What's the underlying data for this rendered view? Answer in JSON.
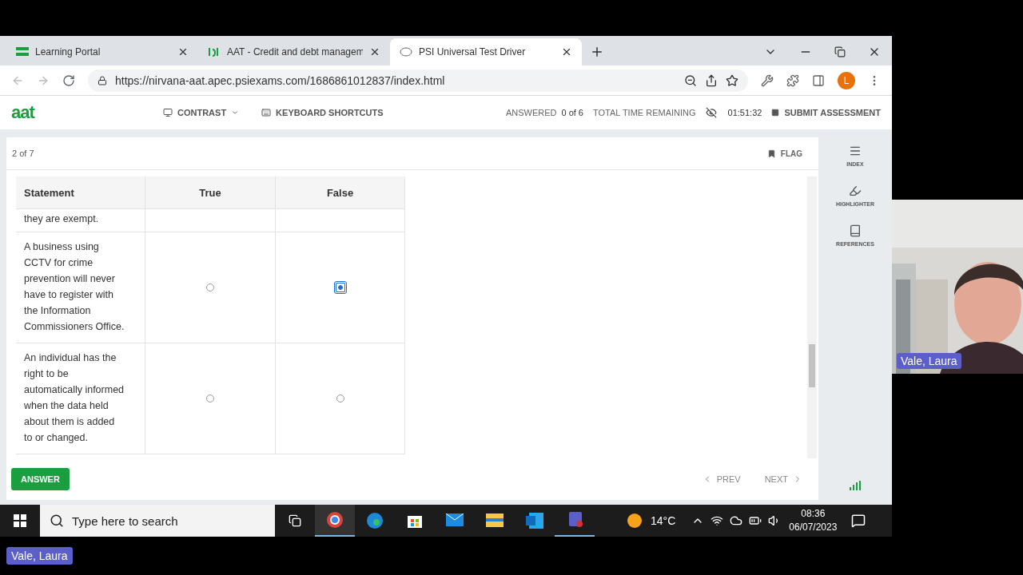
{
  "browser": {
    "tabs": [
      {
        "label": "Learning Portal",
        "kind": "portal",
        "selected": false
      },
      {
        "label": "AAT - Credit and debt managem",
        "kind": "aat",
        "selected": false
      },
      {
        "label": "PSI Universal Test Driver",
        "kind": "psi",
        "selected": true
      }
    ],
    "url": "https://nirvana-aat.apec.psiexams.com/1686861012837/index.html",
    "profile": "L"
  },
  "app": {
    "logo": "aat",
    "toolbar": [
      "CONTRAST",
      "KEYBOARD SHORTCUTS"
    ],
    "answered_label": "ANSWERED",
    "answered": "0 of 6",
    "time_label": "TOTAL TIME REMAINING",
    "time": "01:51:32",
    "submit": "SUBMIT ASSESSMENT"
  },
  "question": {
    "position": "2 of 7",
    "flag": "FLAG",
    "table": {
      "columns": [
        "Statement",
        "True",
        "False"
      ],
      "rows": [
        {
          "statement": "they are exempt."
        },
        {
          "statement": "A business using CCTV for crime prevention will never have to register with the Information Commissioners Office.",
          "options": [
            {
              "selected": false
            },
            {
              "selected": true
            }
          ]
        },
        {
          "statement": "An individual has the right to be automatically informed when the data held about them is added to or changed.",
          "options": [
            {
              "selected": false
            },
            {
              "selected": false
            }
          ]
        }
      ]
    },
    "answer": "ANSWER",
    "prev": "PREV",
    "next": "NEXT"
  },
  "sidebar": [
    {
      "label": "INDEX",
      "kind": "index"
    },
    {
      "label": "HIGHLIGHTER",
      "kind": "highlighter"
    },
    {
      "label": "REFERENCES",
      "kind": "references"
    }
  ],
  "taskbar": {
    "search": "Type here to search",
    "temperature": "14°C",
    "time": "08:36",
    "date": "06/07/2023"
  },
  "video": {
    "name": "Vale, Laura"
  },
  "presenter": "Vale, Laura"
}
